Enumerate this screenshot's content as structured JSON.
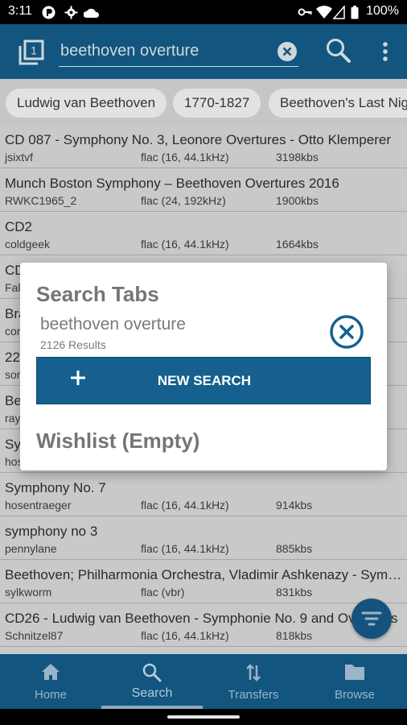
{
  "status_bar": {
    "time": "3:11",
    "battery": "100%",
    "icons": [
      "notification-icon",
      "settings-icon",
      "cloud-icon",
      "vpn-key-icon",
      "wifi-icon",
      "signal-icon",
      "battery-icon"
    ]
  },
  "app_bar": {
    "tab_count": "1",
    "search_value": "beethoven overture",
    "colors": {
      "background": "#12557e",
      "text": "#cfd8dc"
    }
  },
  "chips": [
    "Ludwig van Beethoven",
    "1770-1827",
    "Beethoven's Last Nig"
  ],
  "results": [
    {
      "title": "CD 087 - Symphony No. 3, Leonore Overtures - Otto Klemperer",
      "user": "jsixtvf",
      "format": "flac (16, 44.1kHz)",
      "speed": "3198kbs"
    },
    {
      "title": "Munch Boston Symphony – Beethoven Overtures 2016",
      "user": "RWKC1965_2",
      "format": "flac (24, 192kHz)",
      "speed": "1900kbs"
    },
    {
      "title": "CD2",
      "user": "coldgeek",
      "format": "flac (16, 44.1kHz)",
      "speed": "1664kbs"
    },
    {
      "title": "CD",
      "user": "Fal",
      "format": "",
      "speed": ""
    },
    {
      "title": "Bra",
      "user": "cor",
      "format": "",
      "speed": ""
    },
    {
      "title": "22",
      "user": "sor",
      "format": "",
      "speed": ""
    },
    {
      "title": "Be",
      "user": "ray",
      "format": "",
      "speed": ""
    },
    {
      "title": "Sy",
      "user": "hos",
      "format": "",
      "speed": ""
    },
    {
      "title": "Symphony No. 7",
      "user": "hosentraeger",
      "format": "flac (16, 44.1kHz)",
      "speed": "914kbs"
    },
    {
      "title": "symphony no 3",
      "user": "pennylane",
      "format": "flac (16, 44.1kHz)",
      "speed": "885kbs"
    },
    {
      "title": "Beethoven; Philharmonia Orchestra, Vladimir Ashkenazy - Symphonies",
      "user": "sylkworm",
      "format": "flac (vbr)",
      "speed": "831kbs"
    },
    {
      "title": "CD26 - Ludwig van Beethoven - Symphonie No. 9 and Overtures",
      "user": "Schnitzel87",
      "format": "flac (16, 44.1kHz)",
      "speed": "818kbs"
    }
  ],
  "dialog": {
    "title": "Search Tabs",
    "tab": {
      "query": "beethoven overture",
      "results": "2126 Results"
    },
    "new_search_label": "NEW SEARCH",
    "wishlist_title": "Wishlist (Empty)"
  },
  "bottom_nav": [
    {
      "label": "Home",
      "icon": "home-icon"
    },
    {
      "label": "Search",
      "icon": "search-icon",
      "active": true
    },
    {
      "label": "Transfers",
      "icon": "transfers-icon"
    },
    {
      "label": "Browse",
      "icon": "folder-icon"
    }
  ]
}
